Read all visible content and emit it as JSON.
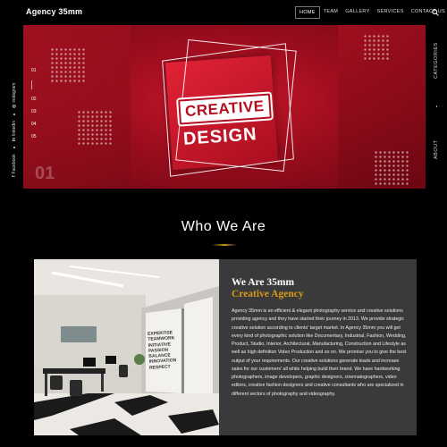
{
  "header": {
    "brand": "Agency 35mm",
    "nav": [
      {
        "label": "HOME",
        "active": true
      },
      {
        "label": "TEAM",
        "active": false
      },
      {
        "label": "GALLERY",
        "active": false
      },
      {
        "label": "SERVICES",
        "active": false
      },
      {
        "label": "CONTACT US",
        "active": false
      }
    ]
  },
  "left_rail": {
    "social": [
      {
        "icon": "facebook-icon",
        "glyph": "f",
        "label": "Facebook"
      },
      {
        "icon": "linkedin-icon",
        "glyph": "in",
        "label": "linkedin"
      },
      {
        "icon": "instagram-icon",
        "glyph": "◎",
        "label": "instagram"
      }
    ]
  },
  "right_rail": {
    "categories_label": "CATEGORIES",
    "about_label": "ABOUT"
  },
  "hero": {
    "slide_numbers": [
      "01",
      "02",
      "03",
      "04",
      "05"
    ],
    "current_slide": "01",
    "logo_line1": "CREATIVE",
    "logo_line2": "DESIGN"
  },
  "about": {
    "section_title": "Who We Are",
    "heading1": "We Are 35mm",
    "heading2": "Creative Agency",
    "body": "Agency 35mm is an efficient & elegant photography service and creative solutions providing agency and they have started their journey in 2013. We provide strategic creative solution according to clients' target market. In Agency 35mm you will get every kind of photographic solution like Documentary, Industrial, Fashion, Wedding, Product, Studio, Interior, Architectural, Manufacturing, Construction and Lifestyle as well as high definition Video Production and so on. We promise you to give the best output of your requirements. Our creative solutions generate leads and increase sales for our customers' all while helping build their brand. We have hardworking photographers, image developers, graphic designers, cinematographers, video editors, creative fashion designers and creative consultants who are specialized in different sectors of photography and videography.",
    "wall_text": [
      "EXPERTISE",
      "TEAMWORK",
      "INITIATIVE",
      "PASSION",
      "BALANCE",
      "INNOVATION",
      "RESPECT"
    ]
  },
  "colors": {
    "accent_gold": "#d89a1c",
    "hero_red": "#b30f20",
    "info_bg": "#3a3a3a"
  }
}
